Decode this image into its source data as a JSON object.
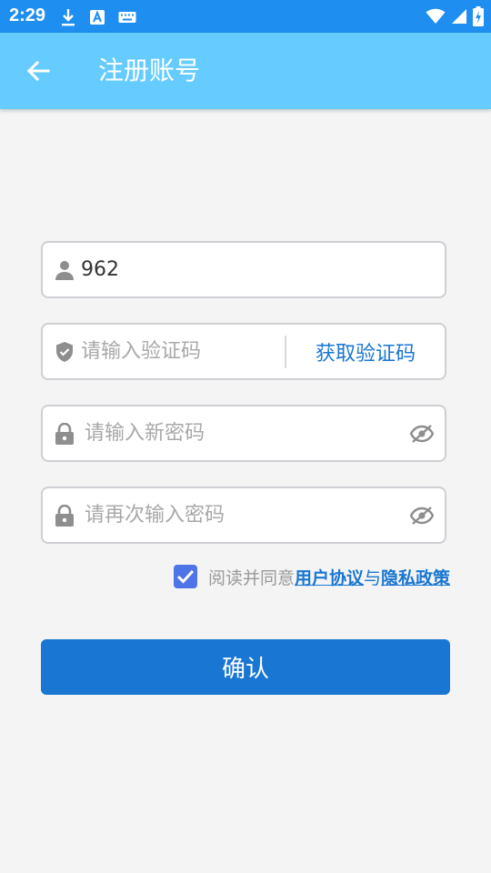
{
  "status_bar": {
    "time": "2:29",
    "icons": [
      "download-icon",
      "text-a-icon",
      "keyboard-icon",
      "wifi-icon",
      "cell-signal-icon",
      "battery-charging-icon"
    ]
  },
  "app_bar": {
    "title": "注册账号",
    "back_icon": "arrow-left-icon"
  },
  "form": {
    "username": {
      "value": "962",
      "icon": "user-icon"
    },
    "verification_code": {
      "placeholder": "请输入验证码",
      "icon": "shield-icon",
      "get_code_label": "获取验证码"
    },
    "new_password": {
      "placeholder": "请输入新密码",
      "icon": "lock-icon",
      "toggle_icon": "eye-off-icon"
    },
    "confirm_password": {
      "placeholder": "请再次输入密码",
      "icon": "lock-icon",
      "toggle_icon": "eye-off-icon"
    }
  },
  "agreement": {
    "checked": true,
    "prefix": "阅读并同意",
    "user_agreement": "用户协议",
    "joiner": "与",
    "privacy_policy": "隐私政策"
  },
  "confirm_label": "确认",
  "colors": {
    "status_bar": "#1e8ef0",
    "app_bar": "#66ccff",
    "primary": "#1976d2",
    "checkbox": "#4f74e8",
    "background": "#f4f4f4"
  }
}
